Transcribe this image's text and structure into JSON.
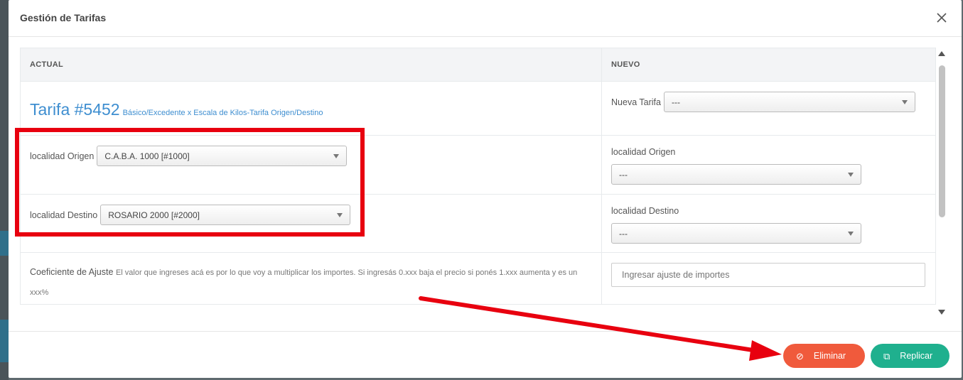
{
  "modal": {
    "title": "Gestión de Tarifas"
  },
  "table": {
    "headers": {
      "actual": "ACTUAL",
      "nuevo": "NUEVO"
    },
    "tarifa": {
      "title": "Tarifa #5452",
      "subtitle": "Básico/Excedente x Escala de Kilos-Tarifa Origen/Destino"
    },
    "nueva_tarifa": {
      "label": "Nueva Tarifa",
      "value": "---"
    },
    "actual_origen": {
      "label": "localidad Origen",
      "value": "C.A.B.A. 1000 [#1000]"
    },
    "actual_destino": {
      "label": "localidad Destino",
      "value": "ROSARIO 2000 [#2000]"
    },
    "nuevo_origen": {
      "label": "localidad Origen",
      "value": "---"
    },
    "nuevo_destino": {
      "label": "localidad Destino",
      "value": "---"
    },
    "coeficiente": {
      "label": "Coeficiente de Ajuste",
      "help": "El valor que ingreses acá es por lo que voy a multiplicar los importes. Si ingresás 0.xxx baja el precio si ponés 1.xxx aumenta y es un xxx%",
      "placeholder": "Ingresar ajuste de importes"
    }
  },
  "footer": {
    "eliminar_label": "Eliminar",
    "replicar_label": "Replicar"
  },
  "colors": {
    "accent_blue": "#3e8ed0",
    "eliminar": "#f05a3c",
    "replicar": "#1fb08e",
    "annotation_red": "#e8000f"
  },
  "icons": {
    "close": "close-icon",
    "eliminar": "ban-icon",
    "replicar": "copy-icon"
  }
}
